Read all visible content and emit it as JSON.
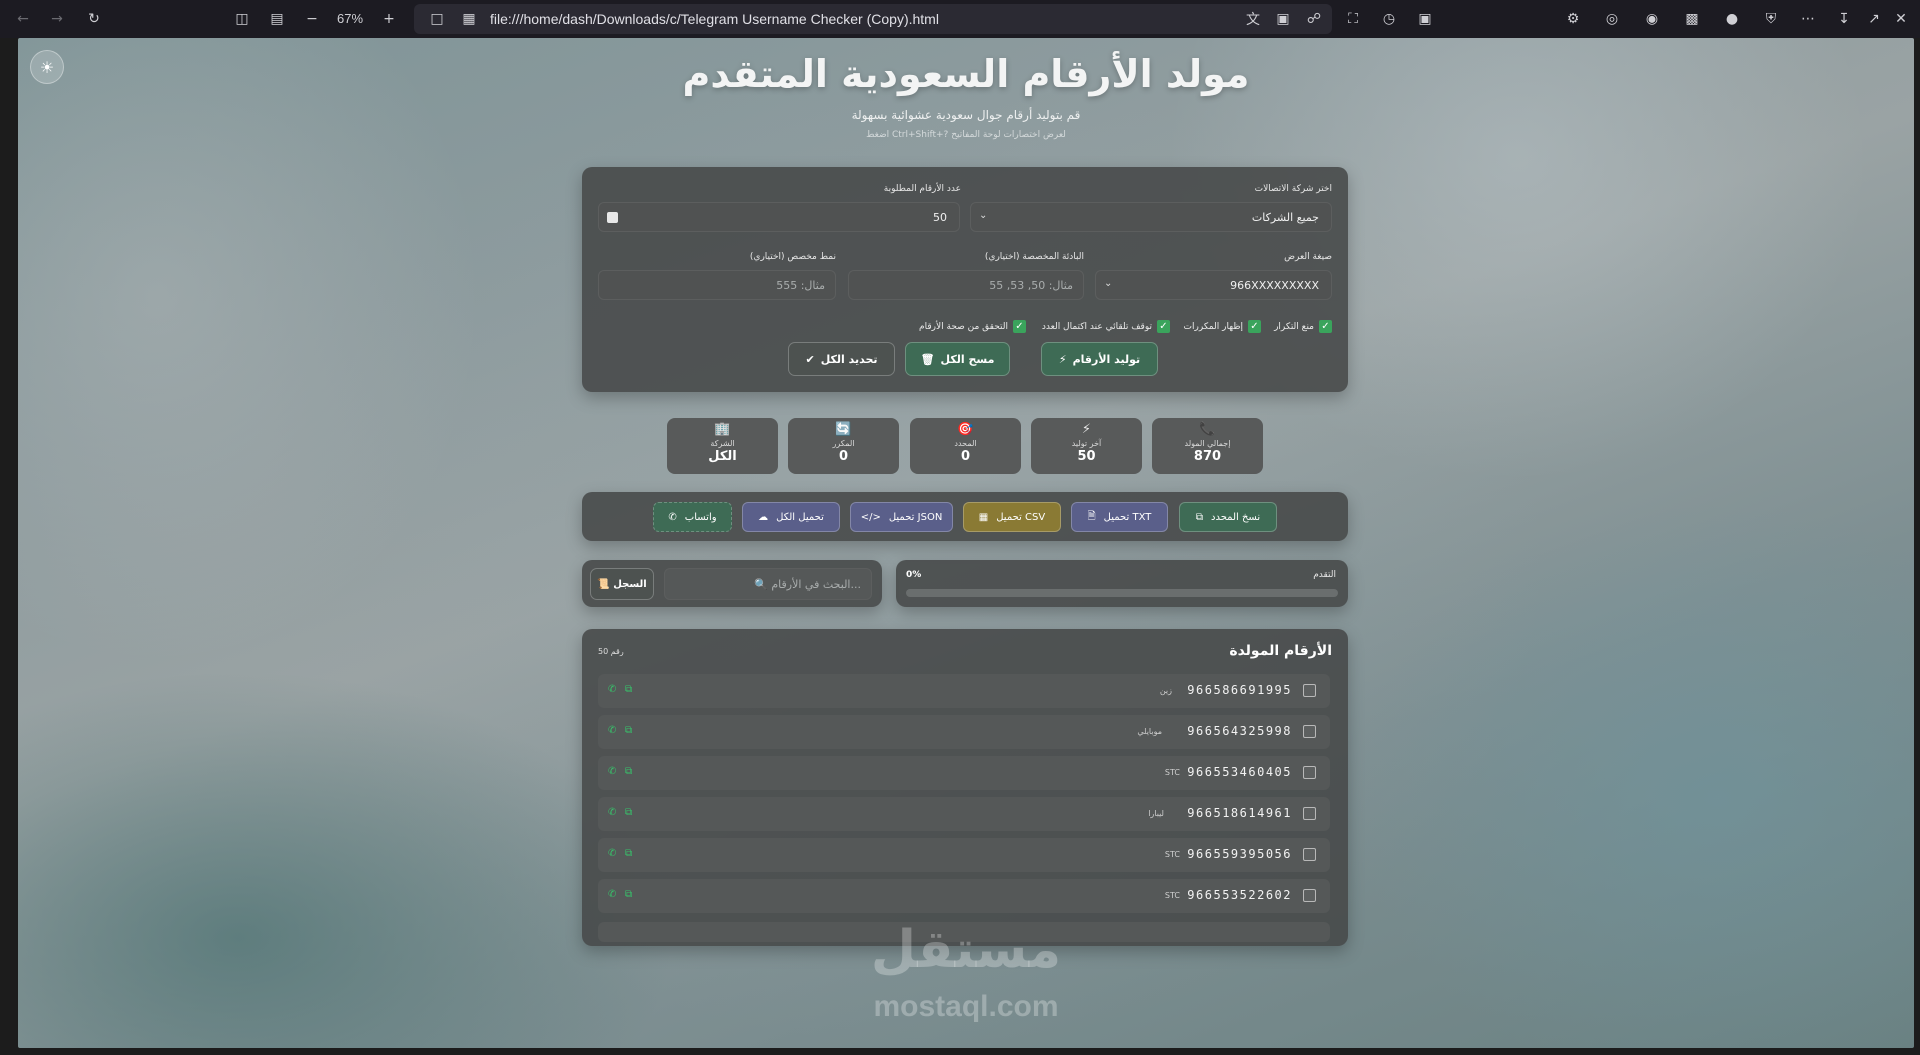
{
  "browser": {
    "zoom": "67%",
    "url": "file:///home/dash/Downloads/c/Telegram Username Checker (Copy).html"
  },
  "header": {
    "title": "مولد الأرقام السعودية المتقدم",
    "subtitle": "قم بتوليد أرقام جوال سعودية عشوائية بسهولة",
    "hint": "اضغط Ctrl+Shift+? لعرض اختصارات لوحة المفاتيح"
  },
  "form": {
    "carrier_label": "اختر شركة الاتصالات",
    "carrier_value": "جميع الشركات",
    "count_label": "عدد الأرقام المطلوبة",
    "count_value": "50",
    "format_label": "صيغة العرض",
    "format_value": "966XXXXXXXXX",
    "prefix_label": "البادئة المخصصة (اختياري)",
    "prefix_placeholder": "مثال: 50, 53, 55",
    "pattern_label": "نمط مخصص (اختياري)",
    "pattern_placeholder": "مثال: 555",
    "options": [
      "منع التكرار",
      "إظهار المكررات",
      "توقف تلقائي عند اكتمال العدد",
      "التحقق من صحة الأرقام"
    ],
    "generate_label": "توليد الأرقام",
    "clear_label": "مسح الكل",
    "select_label": "تحديد الكل"
  },
  "stats": [
    {
      "label": "إجمالي المولد",
      "value": "870",
      "icon": "phone-icon"
    },
    {
      "label": "آخر توليد",
      "value": "50",
      "icon": "lightning-icon"
    },
    {
      "label": "المحدد",
      "value": "0",
      "icon": "target-icon"
    },
    {
      "label": "المكرر",
      "value": "0",
      "icon": "repeat-icon"
    },
    {
      "label": "الشركة",
      "value": "الكل",
      "icon": "building-icon"
    }
  ],
  "downloads": {
    "copy_selected": "نسخ المحدد",
    "txt": "تحميل TXT",
    "csv": "تحميل CSV",
    "json": "تحميل JSON",
    "all": "تحميل الكل",
    "whatsapp": "واتساب"
  },
  "progress": {
    "label": "التقدم",
    "value": "0%",
    "fraction": 0
  },
  "search": {
    "placeholder": "🔍 البحث في الأرقام...",
    "history_label": "📜 السجل"
  },
  "results": {
    "title": "الأرقام المولدة",
    "count": "50 رقم",
    "rows": [
      {
        "number": "966586691995",
        "carrier": "زين"
      },
      {
        "number": "966564325998",
        "carrier": "موبايلي"
      },
      {
        "number": "966553460405",
        "carrier": "STC"
      },
      {
        "number": "966518614961",
        "carrier": "ليبارا"
      },
      {
        "number": "966559395056",
        "carrier": "STC"
      },
      {
        "number": "966553522602",
        "carrier": "STC"
      }
    ]
  },
  "watermark": {
    "brand": "مستقل",
    "domain": "mostaql.com"
  },
  "colors": {
    "accent_green": "#3aa45c",
    "download_txt": "#5a5f8a",
    "download_csv": "#8a7a34",
    "download_json": "#5a5f8a",
    "download_all": "#5a5f8a",
    "whatsapp": "#3e6b55"
  }
}
